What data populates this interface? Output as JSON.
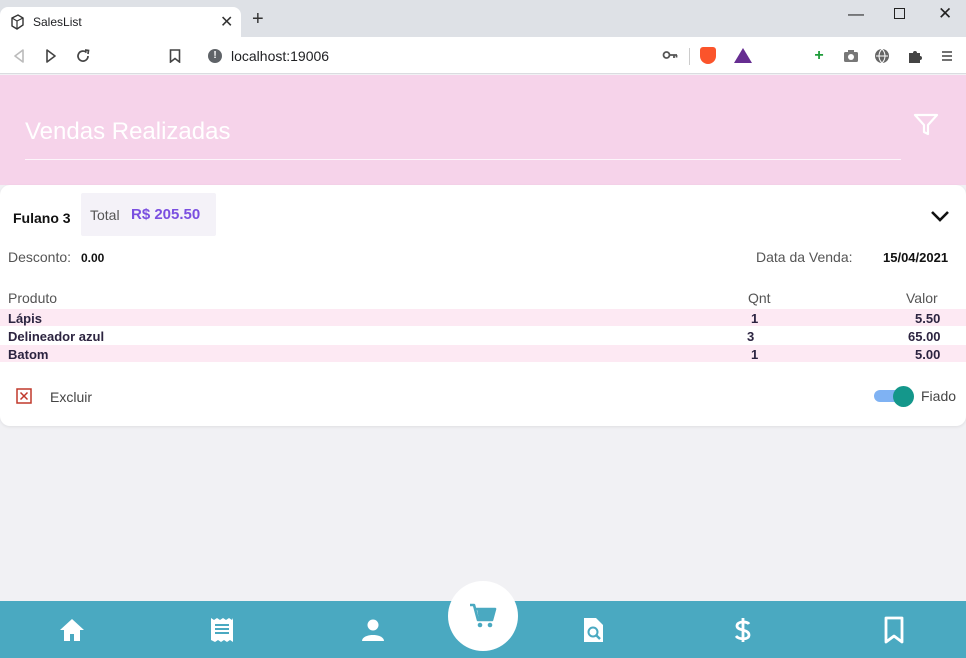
{
  "browser": {
    "tab_title": "SalesList",
    "url": "localhost:19006",
    "new_tab": "+",
    "tab_close": "✕",
    "win_min": "—",
    "win_close": "✕"
  },
  "header": {
    "title": "Vendas Realizadas"
  },
  "sale": {
    "customer": "Fulano 3",
    "total_label": "Total",
    "total_value": "R$ 205.50",
    "discount_label": "Desconto:",
    "discount_value": "0.00",
    "date_label": "Data da Venda:",
    "date_value": "15/04/2021",
    "columns": {
      "product": "Produto",
      "qty": "Qnt",
      "value": "Valor"
    },
    "items": [
      {
        "product": "Lápis",
        "qty": "1",
        "value": "5.50"
      },
      {
        "product": "Delineador azul",
        "qty": "3",
        "value": "65.00"
      },
      {
        "product": "Batom",
        "qty": "1",
        "value": "5.00"
      }
    ],
    "delete_label": "Excluir",
    "fiado_label": "Fiado",
    "fiado_on": true
  },
  "nav": {
    "items": [
      "home-icon",
      "receipt-icon",
      "person-icon",
      "cart-icon",
      "search-document-icon",
      "dollar-icon",
      "bookmark-icon"
    ],
    "icon_color": "#ffffff",
    "bar_color": "#4aa9c1",
    "active_color": "#4aa9c1"
  },
  "colors": {
    "header_bg": "#f6d3ea",
    "total_accent": "#7a4fe0",
    "row_highlight": "#fde9f3",
    "toggle_knob": "#14978b",
    "toggle_track": "#7fb2f3",
    "delete_red": "#c0392b"
  }
}
